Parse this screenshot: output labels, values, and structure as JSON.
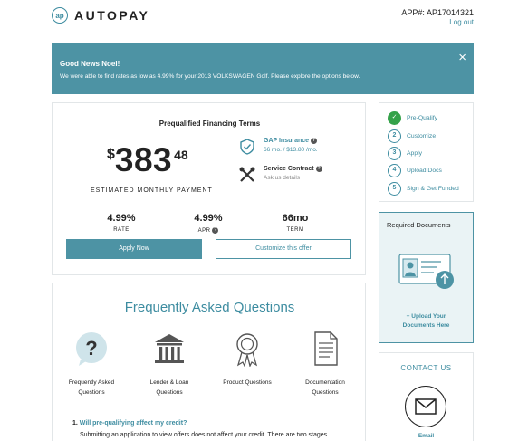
{
  "header": {
    "logo_text": "AUTOPAY",
    "logo_mark": "ap",
    "app_number": "APP#: AP17014321",
    "logout_label": "Log out"
  },
  "banner": {
    "title": "Good News Noel!",
    "message": "We were able to find rates as low as 4.99% for your 2013 VOLKSWAGEN Golf. Please explore the options below.",
    "close_icon": "×"
  },
  "terms": {
    "title": "Prequalified Financing Terms",
    "price_symbol": "$",
    "price_whole": "383",
    "price_cents": "48",
    "price_caption": "ESTIMATED MONTHLY PAYMENT",
    "gap": {
      "title": "GAP Insurance",
      "detail": "66 mo. / $13.80 /mo."
    },
    "service": {
      "title": "Service Contract",
      "detail": "Ask us details"
    },
    "stats": [
      {
        "value": "4.99%",
        "label": "RATE"
      },
      {
        "value": "4.99%",
        "label": "APR"
      },
      {
        "value": "66mo",
        "label": "TERM"
      }
    ],
    "apply_label": "Apply Now",
    "customize_label": "Customize this offer"
  },
  "steps": [
    {
      "marker": "✓",
      "label": "Pre-Qualify",
      "done": true
    },
    {
      "marker": "2",
      "label": "Customize",
      "done": false
    },
    {
      "marker": "3",
      "label": "Apply",
      "done": false
    },
    {
      "marker": "4",
      "label": "Upload Docs",
      "done": false
    },
    {
      "marker": "5",
      "label": "Sign & Get Funded",
      "done": false
    }
  ],
  "required_docs": {
    "title": "Required Documents",
    "link_line1": "+ Upload Your",
    "link_line2": "Documents Here"
  },
  "contact": {
    "title": "CONTACT US",
    "email_label": "Email"
  },
  "faq": {
    "title": "Frequently Asked Questions",
    "categories": [
      {
        "line1": "Frequently Asked",
        "line2": "Questions",
        "icon": "question-icon"
      },
      {
        "line1": "Lender & Loan",
        "line2": "Questions",
        "icon": "bank-icon"
      },
      {
        "line1": "Product Questions",
        "line2": "",
        "icon": "award-icon"
      },
      {
        "line1": "Documentation",
        "line2": "Questions",
        "icon": "document-icon"
      }
    ],
    "q1_number": "1.",
    "q1_text": "Will pre-qualifying affect my credit?",
    "q1_answer": "Submitting an application to view offers does not affect your credit. There are two stages"
  },
  "colors": {
    "accent": "#4d93a4",
    "success": "#35a24a"
  }
}
